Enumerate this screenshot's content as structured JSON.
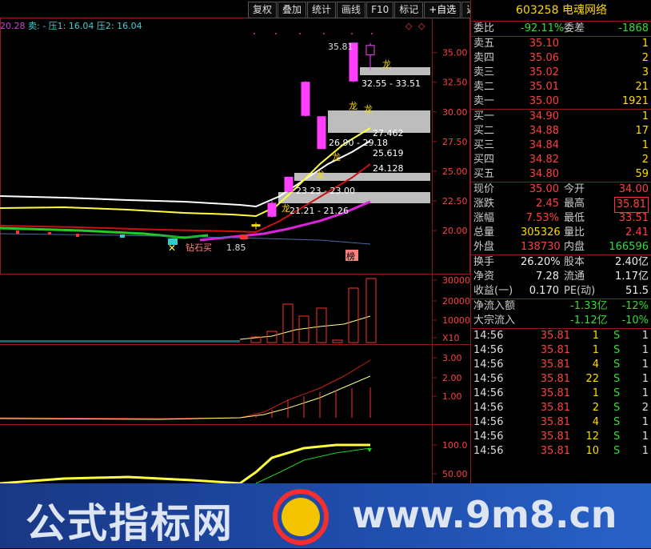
{
  "toolbar": {
    "buttons": [
      "复权",
      "叠加",
      "统计",
      "画线",
      "F10",
      "标记",
      "+自选",
      "返回"
    ]
  },
  "indicator_header": {
    "value": "20.28",
    "sell_label": "卖: -",
    "press1": "压1: 16.04",
    "press2": "压2: 16.04"
  },
  "price_axis": [
    "35.00",
    "32.50",
    "30.00",
    "27.50",
    "25.00",
    "22.50",
    "20.00"
  ],
  "volume_axis": [
    "30000",
    "20000",
    "10000",
    "X10"
  ],
  "macd_axis": [
    "3.00",
    "2.00",
    "1.00"
  ],
  "bottom_axis": [
    "100.0",
    "50.00"
  ],
  "annotations": {
    "high": "35.81",
    "dragon": "龙",
    "zone1": "32.55 - 33.51",
    "zone2": "26.90 - 29.18",
    "zone3": "23.23 - 23.00",
    "zone4": "21.21 - 21.26",
    "ma1": "27.462",
    "ma2": "25.619",
    "ma3": "24.128",
    "low_label": "钻石买",
    "low_value": "1.85",
    "bang": "榜"
  },
  "chart_data": {
    "type": "candlestick",
    "ylim": [
      16.5,
      37
    ],
    "candles": [
      {
        "o": 20.4,
        "c": 20.5,
        "h": 20.7,
        "l": 20.1
      },
      {
        "o": 21.2,
        "c": 22.3,
        "h": 22.5,
        "l": 21.1
      },
      {
        "o": 23.3,
        "c": 24.5,
        "h": 24.5,
        "l": 23.2
      },
      {
        "o": 26.9,
        "c": 29.6,
        "h": 29.6,
        "l": 26.9
      },
      {
        "o": 29.7,
        "c": 32.5,
        "h": 32.6,
        "l": 29.6
      },
      {
        "o": 32.6,
        "c": 35.8,
        "h": 35.8,
        "l": 32.5
      },
      {
        "o": 35.6,
        "c": 34.8,
        "h": 35.81,
        "l": 33.51
      }
    ]
  },
  "panel": {
    "code": "603258",
    "name": "电魂网络",
    "weibi_label": "委比",
    "weibi": "-92.11%",
    "weicha_label": "委差",
    "weicha": "-1868",
    "sell": [
      {
        "label": "卖五",
        "price": "35.10",
        "vol": "1"
      },
      {
        "label": "卖四",
        "price": "35.06",
        "vol": "2"
      },
      {
        "label": "卖三",
        "price": "35.02",
        "vol": "3"
      },
      {
        "label": "卖二",
        "price": "35.01",
        "vol": "21"
      },
      {
        "label": "卖一",
        "price": "35.00",
        "vol": "1921"
      }
    ],
    "buy": [
      {
        "label": "买一",
        "price": "34.90",
        "vol": "1"
      },
      {
        "label": "买二",
        "price": "34.88",
        "vol": "17"
      },
      {
        "label": "买三",
        "price": "34.84",
        "vol": "1"
      },
      {
        "label": "买四",
        "price": "34.82",
        "vol": "2"
      },
      {
        "label": "买五",
        "price": "34.80",
        "vol": "59"
      }
    ],
    "stats": [
      {
        "l1": "现价",
        "v1": "35.00",
        "c1": "red",
        "l2": "今开",
        "v2": "34.00",
        "c2": "red"
      },
      {
        "l1": "涨跌",
        "v1": "2.45",
        "c1": "red",
        "l2": "最高",
        "v2": "35.81",
        "c2": "red"
      },
      {
        "l1": "涨幅",
        "v1": "7.53%",
        "c1": "red",
        "l2": "最低",
        "v2": "33.51",
        "c2": "red"
      },
      {
        "l1": "总量",
        "v1": "305326",
        "c1": "yel",
        "l2": "量比",
        "v2": "2.41",
        "c2": "red"
      },
      {
        "l1": "外盘",
        "v1": "138730",
        "c1": "red",
        "l2": "内盘",
        "v2": "166596",
        "c2": "green"
      }
    ],
    "stats2": [
      {
        "l1": "换手",
        "v1": "26.20%",
        "l2": "股本",
        "v2": "2.40亿"
      },
      {
        "l1": "净资",
        "v1": "7.28",
        "l2": "流通",
        "v2": "1.17亿"
      },
      {
        "l1": "收益(一)",
        "v1": "0.170",
        "l2": "PE(动)",
        "v2": "51.5"
      }
    ],
    "flow": [
      {
        "label": "净流入额",
        "value": "-1.33亿",
        "pct": "-12%"
      },
      {
        "label": "大宗流入",
        "value": "-1.12亿",
        "pct": "-10%"
      }
    ],
    "ticks": [
      {
        "t": "14:56",
        "p": "35.81",
        "q": "1",
        "s": "S",
        "n": "1"
      },
      {
        "t": "14:56",
        "p": "35.81",
        "q": "1",
        "s": "S",
        "n": "1"
      },
      {
        "t": "14:56",
        "p": "35.81",
        "q": "4",
        "s": "S",
        "n": "1"
      },
      {
        "t": "14:56",
        "p": "35.81",
        "q": "22",
        "s": "S",
        "n": "1"
      },
      {
        "t": "14:56",
        "p": "35.81",
        "q": "1",
        "s": "S",
        "n": "1"
      },
      {
        "t": "14:56",
        "p": "35.81",
        "q": "2",
        "s": "S",
        "n": "2"
      },
      {
        "t": "14:56",
        "p": "35.81",
        "q": "4",
        "s": "S",
        "n": "1"
      },
      {
        "t": "14:56",
        "p": "35.81",
        "q": "12",
        "s": "S",
        "n": "1"
      },
      {
        "t": "14:56",
        "p": "35.81",
        "q": "10",
        "s": "S",
        "n": "1"
      }
    ]
  },
  "watermark": {
    "cn": "公式指标网",
    "en": "www.9m8.cn"
  }
}
